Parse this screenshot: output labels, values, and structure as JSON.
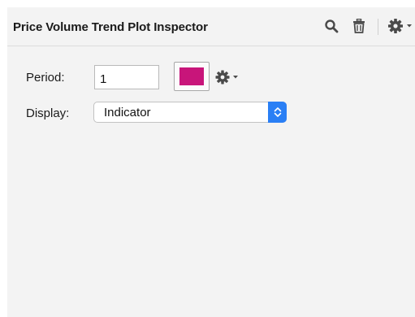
{
  "inspector": {
    "title": "Price Volume Trend Plot Inspector",
    "icons": {
      "search": "search-icon",
      "delete": "trash-icon",
      "settings": "gear-icon"
    }
  },
  "form": {
    "period": {
      "label": "Period:",
      "value": "1",
      "color": "#c8157a"
    },
    "display": {
      "label": "Display:",
      "selected": "Indicator"
    }
  },
  "colors": {
    "panel_bg": "#f3f3f3",
    "accent_blue": "#2a7ff5",
    "icon": "#4a4a4a"
  }
}
